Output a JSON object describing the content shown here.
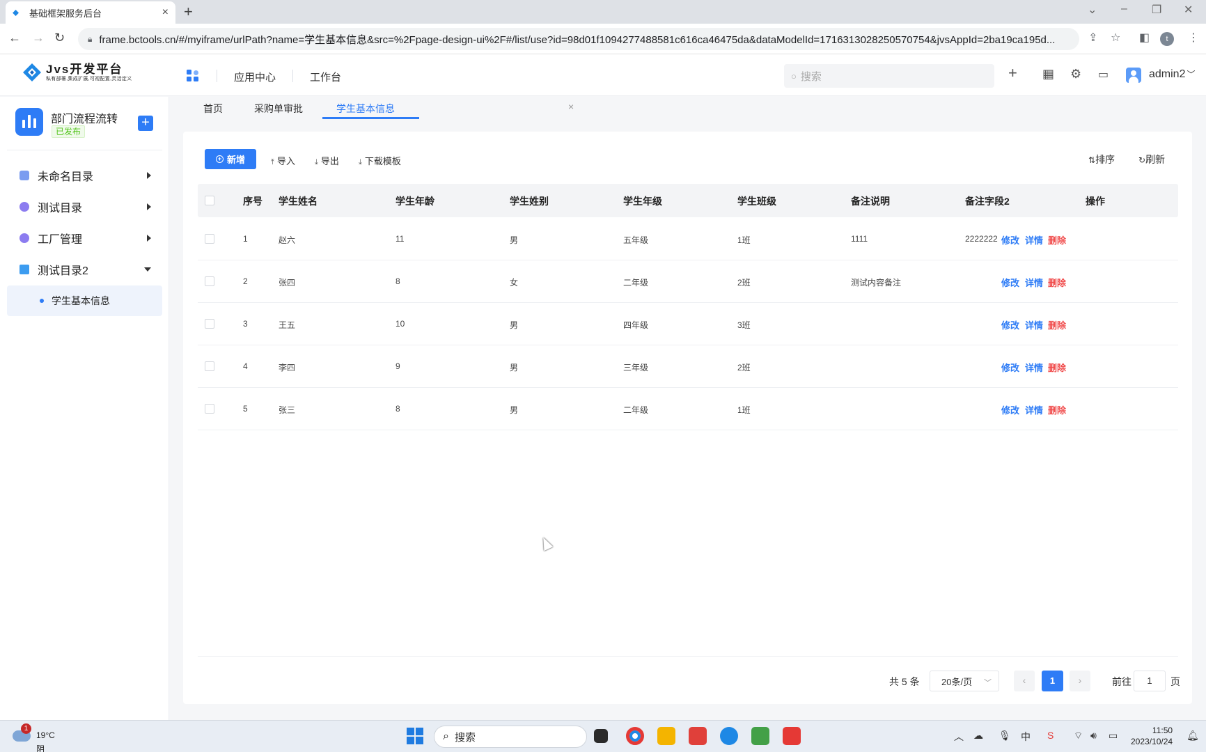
{
  "browser": {
    "tab_title": "基础框架服务后台",
    "url": "frame.bctools.cn/#/myiframe/urlPath?name=学生基本信息&src=%2Fpage-design-ui%2F#/list/use?id=98d01f1094277488581c616ca46475da&dataModelId=1716313028250570754&jvsAppId=2ba19ca195d..."
  },
  "header": {
    "logo_title": "Jvs开发平台",
    "logo_sub": "私有部署,集成扩展,可视配置,灵活定义",
    "links": [
      "应用中心",
      "工作台"
    ],
    "search_placeholder": "搜索",
    "user": "admin2"
  },
  "sidebar": {
    "app_name": "部门流程流转",
    "app_status": "已发布",
    "items": [
      {
        "label": "未命名目录",
        "color": "#7b9cf0"
      },
      {
        "label": "测试目录",
        "color": "#8c7cf0"
      },
      {
        "label": "工厂管理",
        "color": "#8c7cf0"
      },
      {
        "label": "测试目录2",
        "color": "#3c9cf0"
      }
    ],
    "sub_item": "学生基本信息"
  },
  "page_tabs": [
    "首页",
    "采购单审批",
    "学生基本信息"
  ],
  "toolbar": {
    "add": "新增",
    "import": "导入",
    "export": "导出",
    "template": "下载模板",
    "sort": "排序",
    "refresh": "刷新"
  },
  "table": {
    "columns": [
      "序号",
      "学生姓名",
      "学生年龄",
      "学生姓别",
      "学生年级",
      "学生班级",
      "备注说明",
      "备注字段2",
      "操作"
    ],
    "rows": [
      [
        "1",
        "赵六",
        "11",
        "男",
        "五年级",
        "1班",
        "1111",
        "2222222"
      ],
      [
        "2",
        "张四",
        "8",
        "女",
        "二年级",
        "2班",
        "测试内容备注",
        ""
      ],
      [
        "3",
        "王五",
        "10",
        "男",
        "四年级",
        "3班",
        "",
        ""
      ],
      [
        "4",
        "李四",
        "9",
        "男",
        "三年级",
        "2班",
        "",
        ""
      ],
      [
        "5",
        "张三",
        "8",
        "男",
        "二年级",
        "1班",
        "",
        ""
      ]
    ],
    "actions": {
      "edit": "修改",
      "detail": "详情",
      "delete": "删除"
    }
  },
  "pager": {
    "total": "共 5 条",
    "size": "20条/页",
    "current": "1",
    "goto_prefix": "前往",
    "goto_value": "1",
    "goto_suffix": "页"
  },
  "taskbar": {
    "weather_badge": "1",
    "temp": "19°C",
    "cond": "阴",
    "search": "搜索",
    "time": "11:50",
    "date": "2023/10/24"
  },
  "colors": {
    "accent": "#2e7cf6",
    "danger": "#f04b4b",
    "success": "#52c41a"
  }
}
